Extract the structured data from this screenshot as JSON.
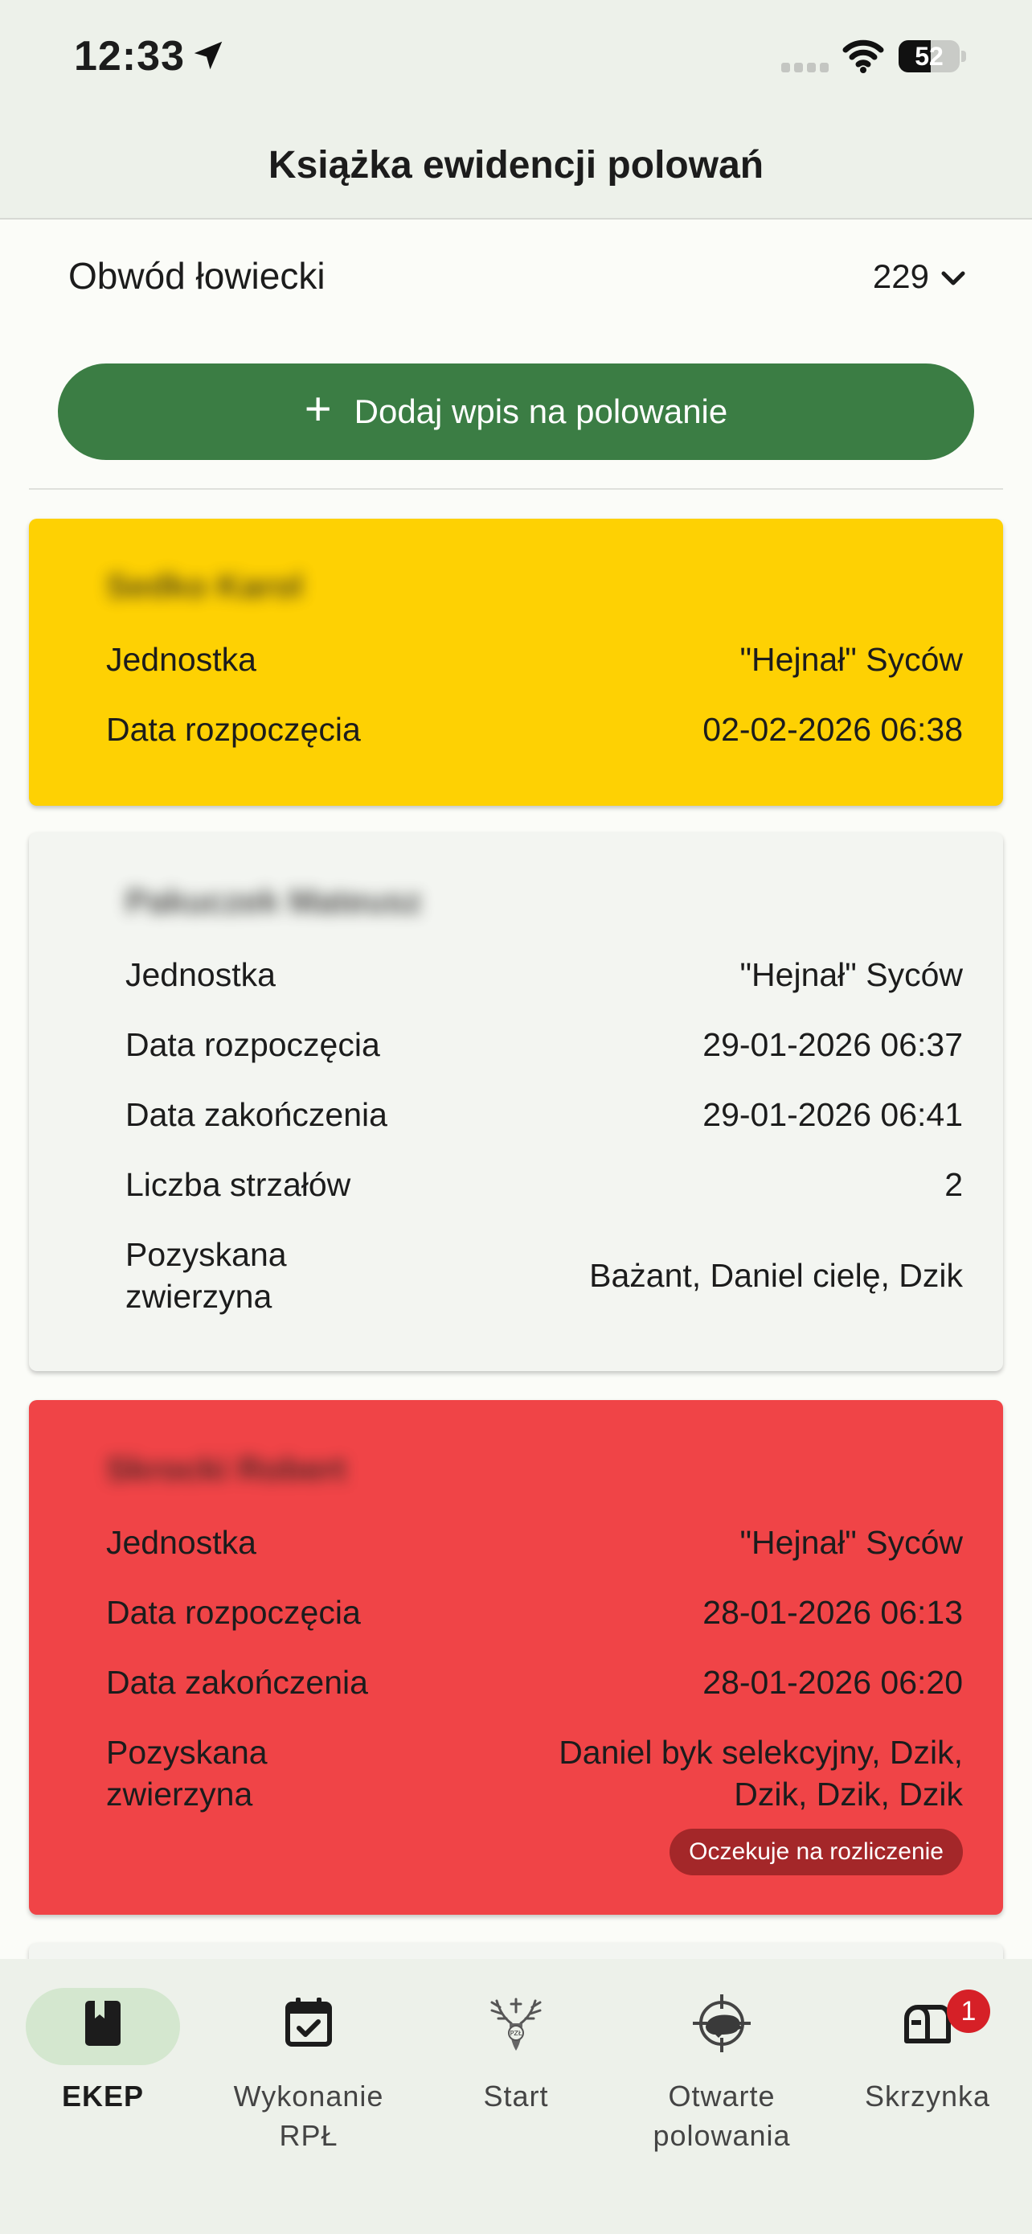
{
  "status_bar": {
    "time": "12:33",
    "battery": "52",
    "battery_level": 0.52
  },
  "header": {
    "title": "Książka ewidencji polowań"
  },
  "district": {
    "label": "Obwód łowiecki",
    "value": "229"
  },
  "add_button": {
    "label": "Dodaj wpis na polowanie"
  },
  "cards": [
    {
      "color": "#fed103",
      "hunter": "Sedko Karol",
      "rows": [
        {
          "label": "Jednostka",
          "value": "\"Hejnał\" Syców"
        },
        {
          "label": "Data rozpoczęcia",
          "value": "02-02-2026 06:38"
        }
      ]
    },
    {
      "color": "#f3f5f1",
      "hunter": "Pakuczek Mateusz",
      "rows": [
        {
          "label": "Jednostka",
          "value": "\"Hejnał\" Syców"
        },
        {
          "label": "Data rozpoczęcia",
          "value": "29-01-2026 06:37"
        },
        {
          "label": "Data zakończenia",
          "value": "29-01-2026 06:41"
        },
        {
          "label": "Liczba strzałów",
          "value": "2"
        },
        {
          "label": "Pozyskana\nzwierzyna",
          "value": "Bażant, Daniel cielę, Dzik"
        }
      ]
    },
    {
      "color": "#f04447",
      "hunter": "Skrocki Robert",
      "rows": [
        {
          "label": "Jednostka",
          "value": "\"Hejnał\" Syców"
        },
        {
          "label": "Data rozpoczęcia",
          "value": "28-01-2026 06:13"
        },
        {
          "label": "Data zakończenia",
          "value": "28-01-2026 06:20"
        },
        {
          "label": "Pozyskana\nzwierzyna",
          "value": "Daniel byk selekcyjny, Dzik,\nDzik, Dzik, Dzik"
        }
      ],
      "badge": "Oczekuje na rozliczenie"
    }
  ],
  "bottom_nav": {
    "items": [
      {
        "label": "EKEP",
        "icon": "book-icon",
        "active": true
      },
      {
        "label": "Wykonanie\nRPŁ",
        "icon": "calendar-check-icon"
      },
      {
        "label": "Start",
        "icon": "deer-emblem-icon"
      },
      {
        "label": "Otwarte\npolowania",
        "icon": "boar-crosshair-icon"
      },
      {
        "label": "Skrzynka",
        "icon": "mailbox-icon",
        "badge": "1"
      }
    ]
  }
}
